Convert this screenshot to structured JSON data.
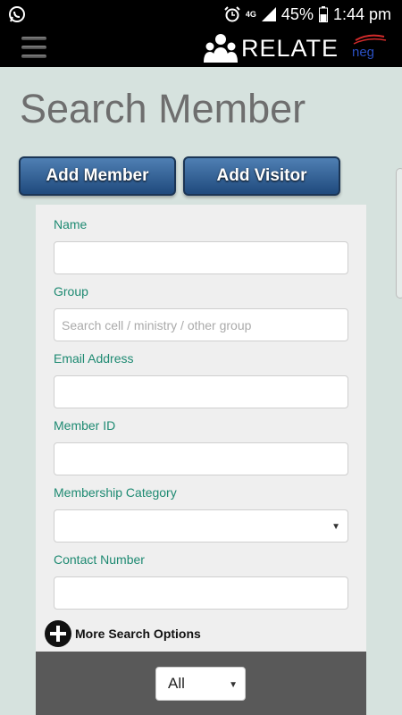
{
  "status_bar": {
    "network": "4G",
    "battery": "45%",
    "time": "1:44 pm"
  },
  "header": {
    "logo_text": "RELATE",
    "partner_logo_text": "neg"
  },
  "page": {
    "title": "Search Member"
  },
  "actions": {
    "add_member": "Add Member",
    "add_visitor": "Add Visitor"
  },
  "form": {
    "name": {
      "label": "Name",
      "value": ""
    },
    "group": {
      "label": "Group",
      "placeholder": "Search cell / ministry / other group"
    },
    "email": {
      "label": "Email Address",
      "value": ""
    },
    "member_id": {
      "label": "Member ID",
      "value": ""
    },
    "membership_category": {
      "label": "Membership Category",
      "value": ""
    },
    "contact_number": {
      "label": "Contact Number",
      "value": ""
    },
    "more_options": "More Search Options"
  },
  "filter": {
    "selected": "All"
  },
  "colors": {
    "label": "#1e8a72",
    "button": "#2f5d93",
    "background": "#d6e2de"
  }
}
